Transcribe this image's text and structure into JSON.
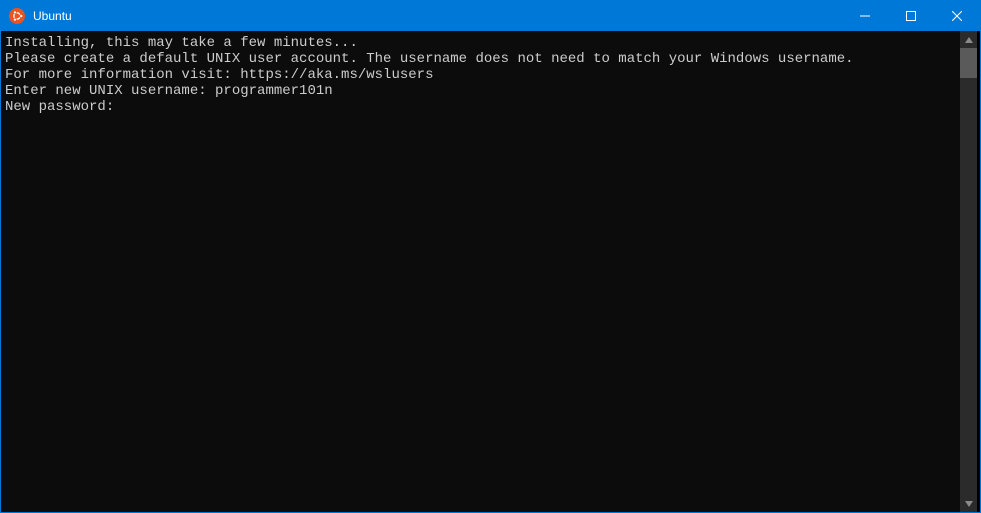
{
  "window": {
    "title": "Ubuntu",
    "icon_color": "#E95420"
  },
  "terminal": {
    "lines": [
      "Installing, this may take a few minutes...",
      "Please create a default UNIX user account. The username does not need to match your Windows username.",
      "For more information visit: https://aka.ms/wslusers",
      "Enter new UNIX username: programmer101n",
      "New password:"
    ]
  }
}
